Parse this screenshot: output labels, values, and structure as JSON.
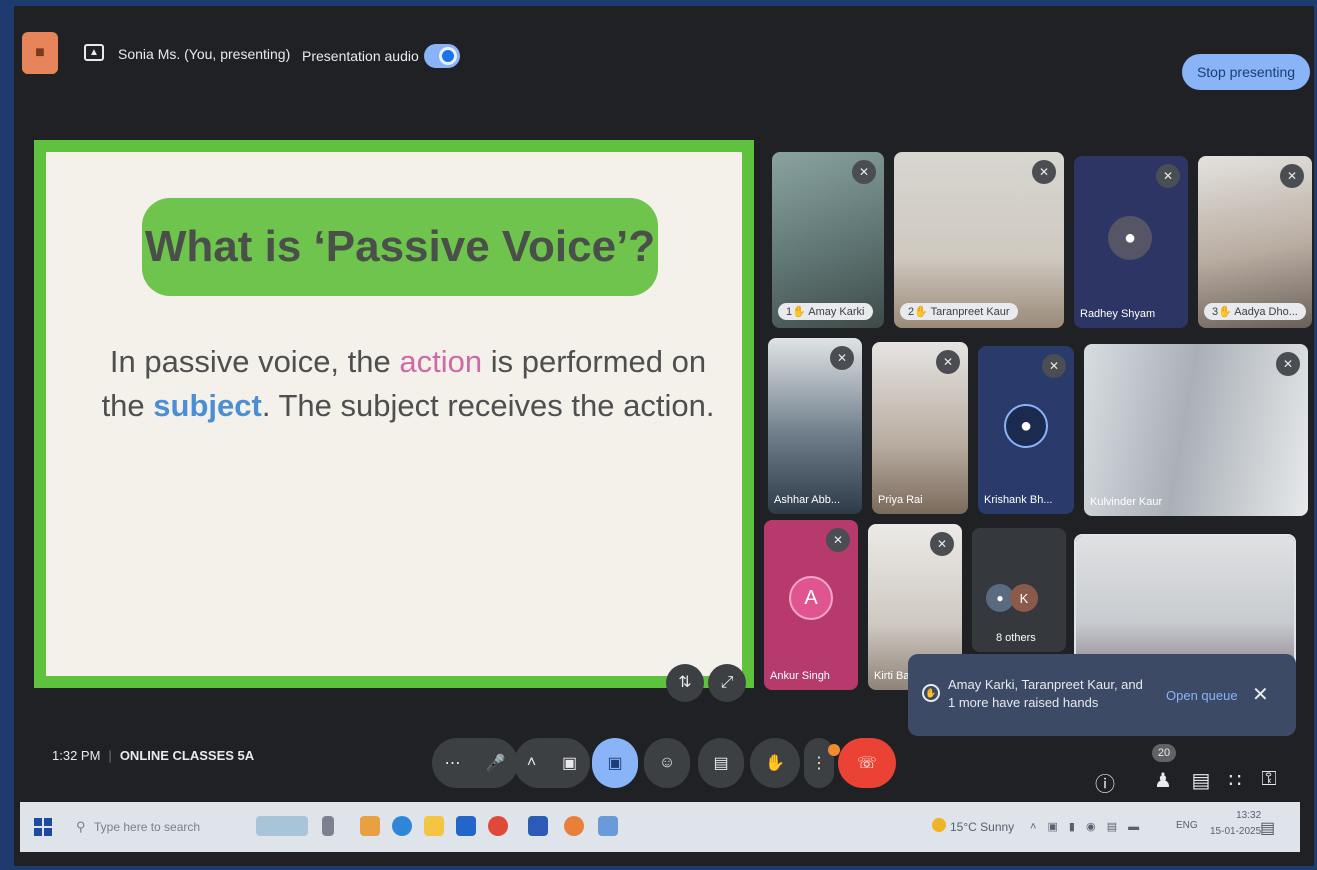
{
  "topbar": {
    "presenter_name": "Sonia Ms. (You, presenting)",
    "audio_label": "Presentation audio",
    "audio_on": true,
    "stop_label": "Stop presenting"
  },
  "slide": {
    "title": "What is ‘Passive Voice’?",
    "line1_before": "In passive voice, the ",
    "line1_highlight": "action",
    "line1_after": " is performed on",
    "line2_before": "the ",
    "line2_highlight": "subject",
    "line2_after": ". The subject receives the action."
  },
  "participants": [
    {
      "name": "1✋ Amay Karki",
      "muted": true
    },
    {
      "name": "2✋ Taranpreet Kaur",
      "muted": true
    },
    {
      "name": "Radhey Shyam",
      "muted": true
    },
    {
      "name": "3✋ Aadya Dho...",
      "muted": true
    },
    {
      "name": "Ashhar Abb...",
      "muted": true
    },
    {
      "name": "Priya Rai",
      "muted": true
    },
    {
      "name": "Krishank Bh...",
      "muted": true
    },
    {
      "name": "Kulvinder Kaur",
      "muted": true
    },
    {
      "name": "Ankur Singh",
      "initial": "A",
      "muted": true
    },
    {
      "name": "Kirti Ba...",
      "muted": true
    },
    {
      "name": "8 others",
      "initial": "K"
    },
    {
      "name": "Sonia Ms.",
      "self": true
    }
  ],
  "toast": {
    "message": "Amay Karki, Taranpreet Kaur, and 1 more have raised hands",
    "action": "Open queue",
    "close": "✕"
  },
  "meeting": {
    "time": "1:32 PM",
    "name": "ONLINE CLASSES 5A",
    "people_count": "20"
  },
  "taskbar": {
    "search_placeholder": "Type here to search",
    "weather": "15°C  Sunny",
    "language": "ENG",
    "clock_time": "13:32",
    "clock_date": "15-01-2025"
  },
  "colors": {
    "slide_green": "#5fc23e",
    "accent_blue": "#8ab4f8",
    "end_call_red": "#ea4335",
    "action_pink": "#d06aa6",
    "subject_blue": "#4a8ed4"
  }
}
